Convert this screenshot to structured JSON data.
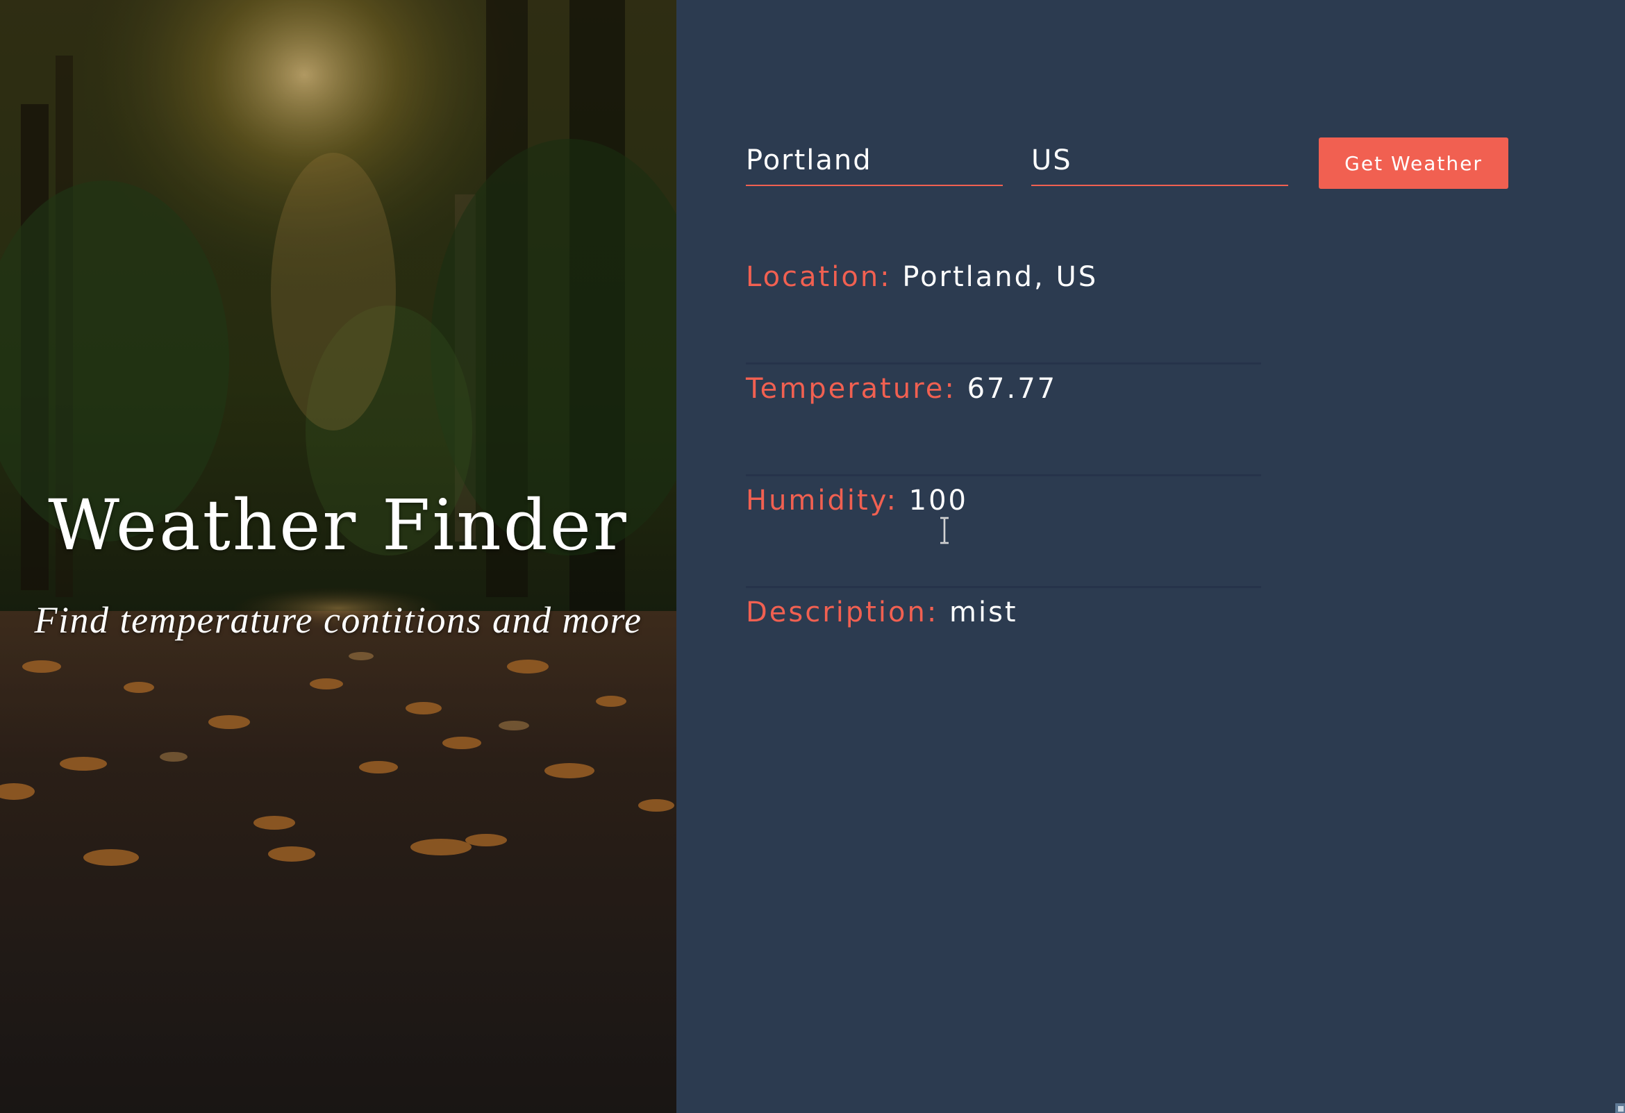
{
  "hero": {
    "title": "Weather Finder",
    "subtitle": "Find temperature contitions and more"
  },
  "form": {
    "city_value": "Portland",
    "country_value": "US",
    "submit_label": "Get Weather"
  },
  "results": [
    {
      "label": "Location:",
      "value": "Portland, US"
    },
    {
      "label": "Temperature:",
      "value": "67.77"
    },
    {
      "label": "Humidity:",
      "value": "100"
    },
    {
      "label": "Description:",
      "value": "mist"
    }
  ],
  "colors": {
    "accent": "#f16051",
    "panel_bg": "#2c3b50",
    "text": "#ffffff"
  },
  "icons": {
    "cursor": "text-cursor-icon"
  }
}
